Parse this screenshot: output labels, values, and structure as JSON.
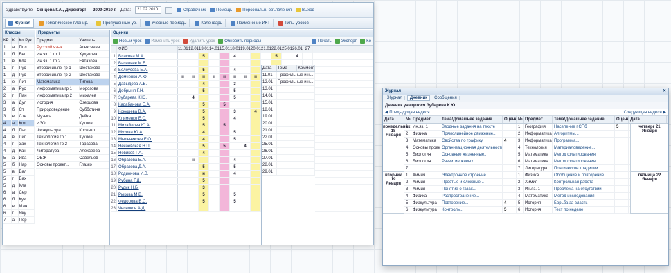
{
  "topbar": {
    "greeting": "Здравствуйте",
    "user": "Сенцова Г.А., Директор!",
    "year": "2009-2010 г.",
    "date_label": "Дата:",
    "date_value": "21.02.2010",
    "links": [
      "Справочник",
      "Помощь",
      "Персональн. объявления",
      "Выход"
    ]
  },
  "tabs": [
    {
      "label": "Журнал",
      "icon": "journal-icon",
      "active": true
    },
    {
      "label": "Тематическое планир.",
      "icon": "plan-icon"
    },
    {
      "label": "Пропущенные ур.",
      "icon": "missed-icon"
    },
    {
      "label": "Учебные периоды",
      "icon": "periods-icon"
    },
    {
      "label": "Календарь",
      "icon": "calendar-icon"
    },
    {
      "label": "Применение ИКТ",
      "icon": "ict-icon"
    },
    {
      "label": "Типы уроков",
      "icon": "lesson-types-icon"
    }
  ],
  "classes": {
    "title": "Классы",
    "columns": [
      "КР",
      "К...",
      "Кл.Рук"
    ],
    "rows": [
      [
        "1",
        "а",
        "Пол"
      ],
      [
        "1",
        "б",
        "Бел"
      ],
      [
        "1",
        "в",
        "Кла"
      ],
      [
        "1",
        "г",
        "Рус"
      ],
      [
        "1",
        "д",
        "Рус"
      ],
      [
        "1",
        "е",
        "Лит"
      ],
      [
        "2",
        "а",
        "Рус"
      ],
      [
        "2",
        "г",
        "Пан"
      ],
      [
        "3",
        "а",
        "Дул"
      ],
      [
        "3",
        "б",
        "Ст"
      ],
      [
        "3",
        "в",
        "Сте"
      ],
      [
        "4",
        "а",
        "Кол"
      ],
      [
        "4",
        "б",
        "Пас"
      ],
      [
        "4",
        "в",
        "Лип"
      ],
      [
        "4",
        "г",
        "Зах"
      ],
      [
        "4",
        "д",
        "Кан"
      ],
      [
        "5",
        "а",
        "Ива"
      ],
      [
        "5",
        "б",
        "Нар"
      ],
      [
        "5",
        "в",
        "Вал"
      ],
      [
        "5",
        "г",
        "Бах"
      ],
      [
        "5",
        "д",
        "Кла"
      ],
      [
        "6",
        "а",
        "Сер"
      ],
      [
        "6",
        "б",
        "Куз"
      ],
      [
        "6",
        "в",
        "Ман"
      ],
      [
        "6",
        "г",
        "Яку"
      ],
      [
        "7",
        "а",
        "Пер"
      ]
    ]
  },
  "subjects": {
    "title": "Предметы",
    "columns": [
      "Предмет",
      "Учитель"
    ],
    "rows": [
      [
        "Русский язык",
        "Алексеева"
      ],
      [
        "Ин.яз. 1 гр 1",
        "Худякова"
      ],
      [
        "Ин.яз. 1 гр 2",
        "Евтахова"
      ],
      [
        "Второй ин.яз. гр 1",
        "Шестакова"
      ],
      [
        "Второй ин.яз. гр 2",
        "Шестакова"
      ],
      [
        "Математика",
        "Титова"
      ],
      [
        "Информатика гр 1",
        "Морозова"
      ],
      [
        "Информатика гр 2",
        "Михалев"
      ],
      [
        "История",
        "Озерцова"
      ],
      [
        "Природоведение",
        "Субботина"
      ],
      [
        "Музыка",
        "Дейка"
      ],
      [
        "ИЗО",
        "Куклов"
      ],
      [
        "Физкультура",
        "Косенко"
      ],
      [
        "Технология гр 1",
        "Куклов"
      ],
      [
        "Технология гр 2",
        "Тарасова"
      ],
      [
        "Литература",
        "Алексеева"
      ],
      [
        "ОБЖ",
        "Савельев"
      ],
      [
        "Основы проект...",
        "Глазко"
      ]
    ]
  },
  "journal": {
    "title": "Оценки",
    "toolbar": [
      "Новый урок",
      "Изменить урок",
      "Удалить урок",
      "Обновить периоды"
    ],
    "toolbar_right": [
      "Печать",
      "Экспорт",
      "Ко"
    ],
    "fio_header": "ФИО",
    "dates": [
      "11.01",
      "12.01",
      "13.01",
      "14.01",
      "15.01",
      "18.01",
      "19.01",
      "20.01",
      "21.01",
      "22.01",
      "25.01",
      "26.01",
      "27"
    ],
    "yellow_cols": [
      2,
      7,
      9
    ],
    "pink_cols": [
      4
    ],
    "students": [
      {
        "name": "Власова М.А.",
        "marks": [
          "",
          "",
          "5",
          "",
          "",
          "4",
          "",
          "",
          "",
          "5",
          "",
          "4",
          ""
        ]
      },
      {
        "name": "Васильев М.Е.",
        "marks": [
          "",
          "",
          "",
          "",
          "",
          "",
          "",
          "",
          "",
          "",
          "",
          "",
          ""
        ]
      },
      {
        "name": "Белоусова Е.А.",
        "marks": [
          "",
          "",
          "5",
          "",
          "",
          "4",
          "",
          "",
          "",
          "5",
          "",
          "",
          ""
        ]
      },
      {
        "name": "Демченко А.Ю.",
        "marks": [
          "н",
          "н",
          "н",
          "н",
          "н",
          "н",
          "н",
          "н",
          "",
          "",
          "",
          "",
          ""
        ]
      },
      {
        "name": "Давыдова А.В.",
        "marks": [
          "",
          "",
          "4",
          "",
          "",
          "3",
          "",
          "",
          "",
          "",
          "",
          "",
          ""
        ]
      },
      {
        "name": "Добрыня Г.Н.",
        "marks": [
          "",
          "",
          "5",
          "",
          "",
          "5",
          "",
          "",
          "",
          "",
          "",
          "",
          ""
        ]
      },
      {
        "name": "Зубарева К.Ю.",
        "marks": [
          "",
          "4",
          "",
          "",
          "",
          "5",
          "",
          "",
          "",
          "5",
          "",
          "",
          ""
        ]
      },
      {
        "name": "Карабанова Е.А.",
        "marks": [
          "",
          "",
          "5",
          "",
          "5",
          "",
          "",
          "",
          "",
          "",
          "",
          "",
          ""
        ]
      },
      {
        "name": "Кокушева В.А.",
        "marks": [
          "",
          "",
          "5",
          "",
          "",
          "3",
          "",
          "4",
          "",
          "4",
          "",
          "",
          ""
        ]
      },
      {
        "name": "Клименко Е.С.",
        "marks": [
          "",
          "",
          "5",
          "",
          "",
          "4",
          "",
          "",
          "",
          "4",
          "",
          "",
          ""
        ]
      },
      {
        "name": "Михайлова Ю.А.",
        "marks": [
          "",
          "",
          "5",
          "",
          "5",
          "",
          "",
          "",
          "",
          "4",
          "",
          "",
          ""
        ]
      },
      {
        "name": "Мухова Ю.А.",
        "marks": [
          "",
          "",
          "4",
          "",
          "",
          "5",
          "",
          "",
          "н",
          "н",
          "",
          "н",
          ""
        ]
      },
      {
        "name": "Мыльникова Е.О.",
        "marks": [
          "",
          "",
          "4",
          "",
          "",
          "5",
          "",
          "",
          "",
          "4",
          "",
          "5",
          ""
        ]
      },
      {
        "name": "Нечаевская Н.П.",
        "marks": [
          "",
          "",
          "5",
          "",
          "5",
          "",
          "4",
          "",
          "",
          "5",
          "",
          "",
          ""
        ]
      },
      {
        "name": "Новиков Г.А.",
        "marks": [
          "",
          "",
          "4",
          "",
          "",
          "",
          "",
          "",
          "",
          "",
          "",
          "",
          ""
        ]
      },
      {
        "name": "Образова Е.А.",
        "marks": [
          "",
          "н",
          "",
          "",
          "",
          "4",
          "",
          "",
          "",
          "5",
          "",
          "4",
          ""
        ]
      },
      {
        "name": "Образова Д.А.",
        "marks": [
          "",
          "",
          "5",
          "",
          "",
          "5",
          "",
          "",
          "",
          "5",
          "",
          "4",
          ""
        ]
      },
      {
        "name": "Родионова И.В.",
        "marks": [
          "",
          "",
          "н",
          "",
          "",
          "4",
          "",
          "",
          "",
          "5",
          "",
          "",
          ""
        ]
      },
      {
        "name": "Рубина Г.Д.",
        "marks": [
          "",
          "",
          "5",
          "",
          "",
          "",
          "",
          "",
          "",
          "",
          "",
          "",
          ""
        ]
      },
      {
        "name": "Рудик Н.Б.",
        "marks": [
          "",
          "",
          "3",
          "",
          "",
          "",
          "",
          "",
          "",
          "4",
          "",
          "",
          ""
        ]
      },
      {
        "name": "Рыкова М.В.",
        "marks": [
          "",
          "",
          "5",
          "",
          "",
          "5",
          "",
          "",
          "",
          "4",
          "",
          "",
          ""
        ]
      },
      {
        "name": "Федорова В.С.",
        "marks": [
          "",
          "",
          "5",
          "",
          "",
          "5",
          "",
          "",
          "",
          "",
          "5",
          "",
          "5"
        ]
      },
      {
        "name": "Чесноков А.Д.",
        "marks": [
          "",
          "",
          "",
          "",
          "",
          "",
          "",
          "",
          "",
          "",
          "",
          "",
          ""
        ]
      }
    ]
  },
  "lessons_panel": {
    "columns": [
      "Дата",
      "Тема",
      "Комментарии"
    ],
    "rows": [
      [
        "11.01",
        "Профильные и н..."
      ],
      [
        "12.01",
        "Профильные и н..."
      ],
      [
        "13.01",
        ""
      ],
      [
        "14.01",
        ""
      ],
      [
        "15.01",
        ""
      ],
      [
        "18.01",
        ""
      ],
      [
        "19.01",
        ""
      ],
      [
        "20.01",
        ""
      ],
      [
        "21.01",
        ""
      ],
      [
        "22.01",
        ""
      ],
      [
        "25.01",
        ""
      ],
      [
        "26.01",
        ""
      ],
      [
        "27.01",
        ""
      ],
      [
        "28.01",
        ""
      ],
      [
        "29.01",
        ""
      ]
    ]
  },
  "diary": {
    "window_title": "Журнал",
    "tabs": [
      "Журнал",
      "Дневник",
      "Сообщения"
    ],
    "header": "Дневник учащегося Зубарева К.Ю.",
    "prev_week": "Предыдущая неделя",
    "next_week": "Следующая неделя",
    "columns": [
      "Дата",
      "№",
      "Предмет",
      "Тема/Домашнее задание",
      "Оценка",
      "№",
      "Предмет",
      "Тема/Домашнее задание",
      "Оценка",
      "Дата"
    ],
    "day_left_1": "понедельник 18 Января",
    "day_right_1": "четверг 21 Января",
    "day_left_2": "вторник 19 Января",
    "day_right_2": "пятница 22 Января",
    "week1": [
      [
        "1",
        "Ин.яз. 1",
        "Вводные задания на тексте",
        "",
        "1",
        "География",
        "Население г.СПб",
        "5"
      ],
      [
        "2",
        "Физика",
        "Прямолинейное движение...",
        "",
        "2",
        "Информатика",
        "Алгоритмы...",
        ""
      ],
      [
        "3",
        "Математика",
        "Свойства по графику",
        "4",
        "3",
        "Информатика",
        "Программа...",
        ""
      ],
      [
        "4",
        "Основы проект.",
        "Организационная деятельность",
        "",
        "4",
        "Технология",
        "Материаловедение...",
        ""
      ],
      [
        "5",
        "Биология",
        "Основные жизненные...",
        "",
        "5",
        "Математика",
        "Метод флатирования",
        ""
      ],
      [
        "6",
        "Биология",
        "Развитие живых...",
        "",
        "6",
        "Математика",
        "Метод флатирования",
        ""
      ],
      [
        "7",
        "",
        "",
        "",
        "7",
        "Литература",
        "Поэтические традиции",
        ""
      ]
    ],
    "week2": [
      [
        "1",
        "Химия",
        "Электронное строение...",
        "",
        "1",
        "Физика",
        "Обобщение и повторение...",
        ""
      ],
      [
        "2",
        "Химия",
        "Простые и сложные...",
        "",
        "2",
        "Химия",
        "Контрольная работа",
        ""
      ],
      [
        "3",
        "Химия",
        "Понятие о газах...",
        "",
        "3",
        "Ин.яз. 1",
        "Проблема на отсутствии",
        ""
      ],
      [
        "4",
        "Физика",
        "Распространение...",
        "",
        "4",
        "Математика",
        "Метод исследования",
        ""
      ],
      [
        "5",
        "Физкультура",
        "Повторение...",
        "4",
        "5",
        "История",
        "Борьба за власть",
        ""
      ],
      [
        "6",
        "Физкультура",
        "Контроль...",
        "5",
        "6",
        "История",
        "Тест по неделе",
        ""
      ]
    ]
  }
}
